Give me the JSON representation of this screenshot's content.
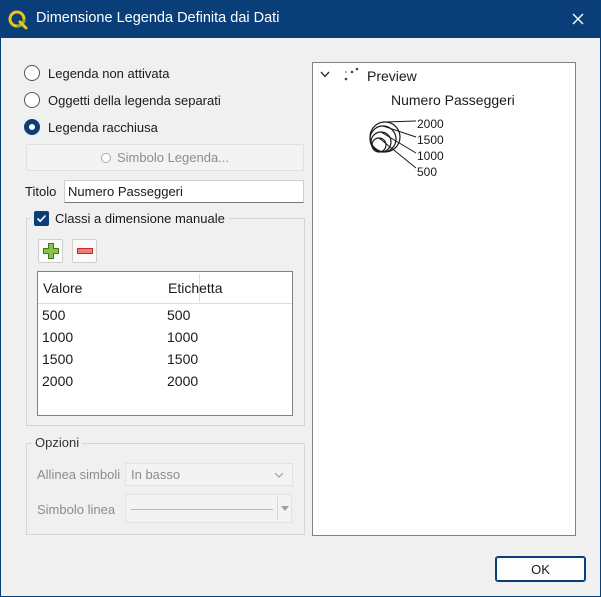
{
  "window": {
    "title": "Dimensione Legenda Definita dai Dati",
    "close_icon": "close-icon",
    "accent_color": "#0a3e78"
  },
  "legend_mode": {
    "options": [
      {
        "label": "Legenda non attivata",
        "selected": false
      },
      {
        "label": "Oggetti della legenda separati",
        "selected": false
      },
      {
        "label": "Legenda racchiusa",
        "selected": true
      }
    ],
    "symbol_button_label": "Simbolo Legenda..."
  },
  "title_field": {
    "label": "Titolo",
    "value": "Numero Passeggeri"
  },
  "manual_classes": {
    "label": "Classi a dimensione manuale",
    "checked": true,
    "add_icon": "plus-icon",
    "remove_icon": "minus-icon",
    "table": {
      "columns": [
        "Valore",
        "Etichetta"
      ],
      "rows": [
        {
          "value": "500",
          "label": "500"
        },
        {
          "value": "1000",
          "label": "1000"
        },
        {
          "value": "1500",
          "label": "1500"
        },
        {
          "value": "2000",
          "label": "2000"
        }
      ]
    }
  },
  "options_group": {
    "label": "Opzioni",
    "align_label": "Allinea simboli",
    "align_value": "In basso",
    "line_symbol_label": "Simbolo linea"
  },
  "preview": {
    "node_label": "Preview",
    "legend_title": "Numero Passeggeri",
    "legend_labels": [
      "2000",
      "1500",
      "1000",
      "500"
    ]
  },
  "footer": {
    "ok_label": "OK"
  }
}
